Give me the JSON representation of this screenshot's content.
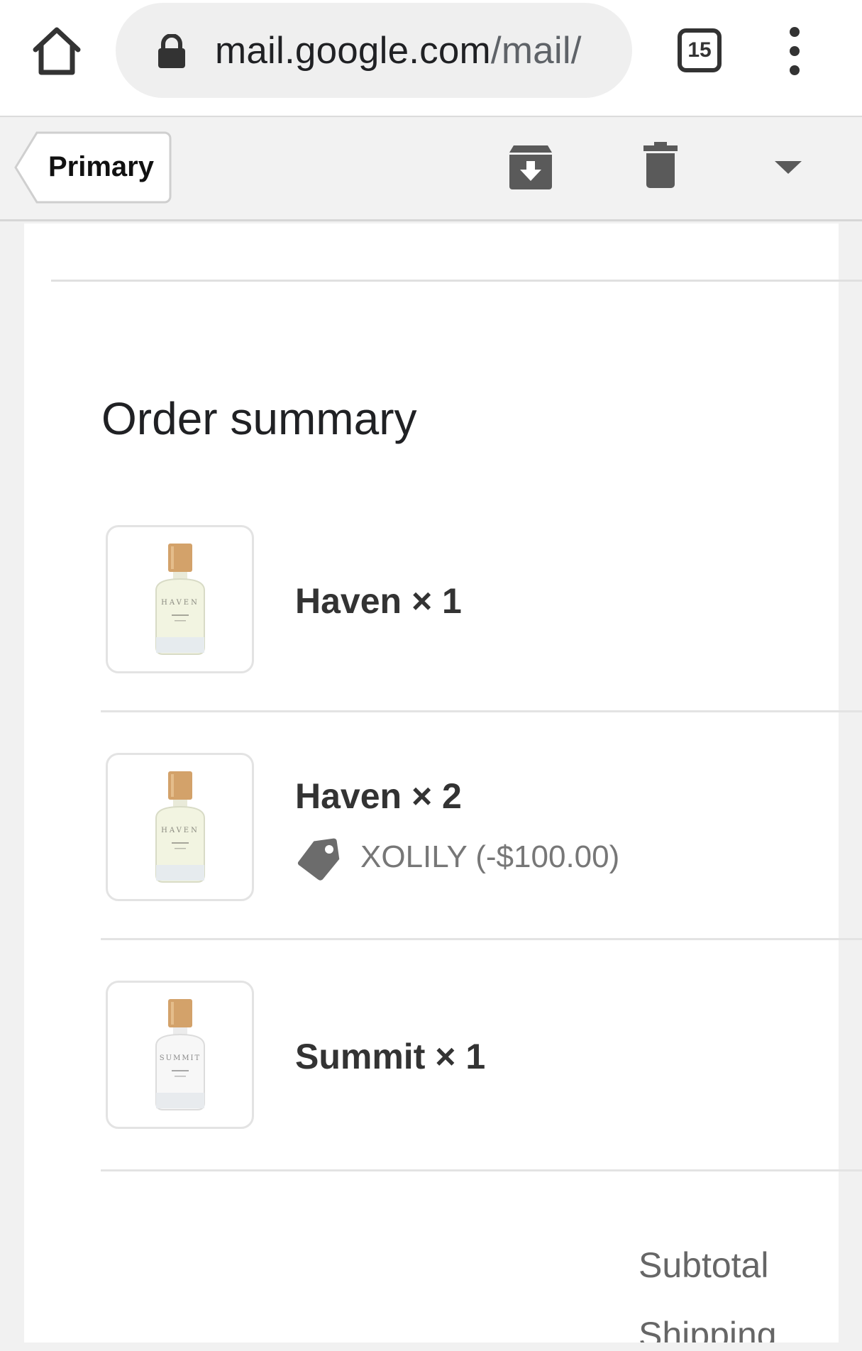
{
  "browser": {
    "url_host": "mail.google.com",
    "url_path": "/mail/",
    "tab_count": "15"
  },
  "toolbar": {
    "back_label": "Primary"
  },
  "email": {
    "section_title": "Order summary",
    "items": [
      {
        "name": "Haven × 1",
        "label_on_bottle": "HAVEN"
      },
      {
        "name": "Haven × 2",
        "label_on_bottle": "HAVEN",
        "discount": "XOLILY (-$100.00)"
      },
      {
        "name": "Summit × 1",
        "label_on_bottle": "SUMMIT"
      }
    ],
    "totals": {
      "subtotal_label": "Subtotal",
      "shipping_label": "Shipping"
    }
  }
}
